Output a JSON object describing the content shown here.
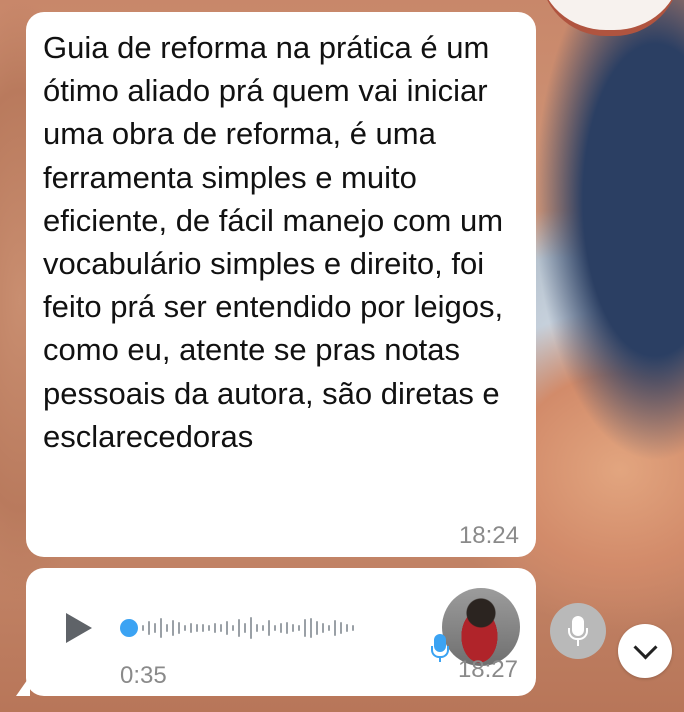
{
  "messages": [
    {
      "type": "text",
      "text": "Guia de reforma na prática é um ótimo aliado prá quem vai iniciar uma obra de reforma, é uma ferramenta simples e muito eficiente, de fácil manejo com um vocabulário simples e direito, foi feito prá ser entendido por leigos, como eu, atente se pras notas pessoais da autora, são diretas e esclarecedoras",
      "time": "18:24"
    },
    {
      "type": "audio",
      "duration": "0:35",
      "time": "18:27",
      "progress": 0
    }
  ],
  "icons": {
    "play": "play-icon",
    "mic_status": "mic-icon",
    "record": "microphone-icon",
    "scroll_down": "chevron-down-icon"
  },
  "colors": {
    "bubble": "#ffffff",
    "accent": "#3ba3f3",
    "meta": "#8a8a8a"
  }
}
